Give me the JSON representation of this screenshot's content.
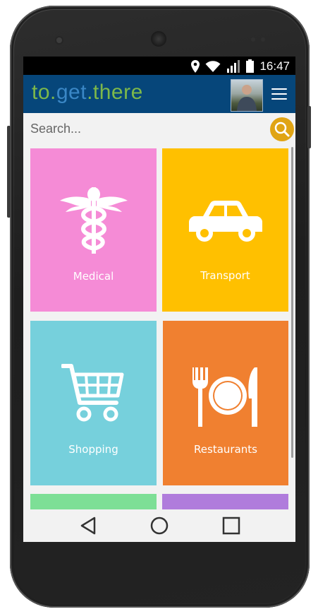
{
  "status_bar": {
    "time": "16:47",
    "icons": [
      "location-icon",
      "wifi-icon",
      "signal-icon",
      "battery-icon"
    ]
  },
  "header": {
    "logo_parts": [
      "to.",
      "get",
      ".there"
    ],
    "avatar": "user-avatar",
    "menu_icon": "hamburger-menu-icon"
  },
  "search": {
    "placeholder": "Search...",
    "value": "",
    "button_icon": "search-icon"
  },
  "categories": [
    {
      "label": "Medical",
      "icon": "caduceus-icon",
      "color": "#f58bd6"
    },
    {
      "label": "Transport",
      "icon": "car-icon",
      "color": "#ffc000"
    },
    {
      "label": "Shopping",
      "icon": "shopping-cart-icon",
      "color": "#76d0dc"
    },
    {
      "label": "Restaurants",
      "icon": "fork-plate-knife-icon",
      "color": "#f08030"
    },
    {
      "label": "",
      "icon": "",
      "color": "#7ddf96"
    },
    {
      "label": "",
      "icon": "",
      "color": "#b07cdc"
    }
  ],
  "colors": {
    "header": "#06467a",
    "logo_green": "#7db84a",
    "logo_blue": "#3a87c6",
    "logo_yellow": "#e9d21b",
    "search_button": "#e0a414"
  },
  "nav_bar": {
    "buttons": [
      "back-icon",
      "home-icon",
      "recents-icon"
    ]
  }
}
